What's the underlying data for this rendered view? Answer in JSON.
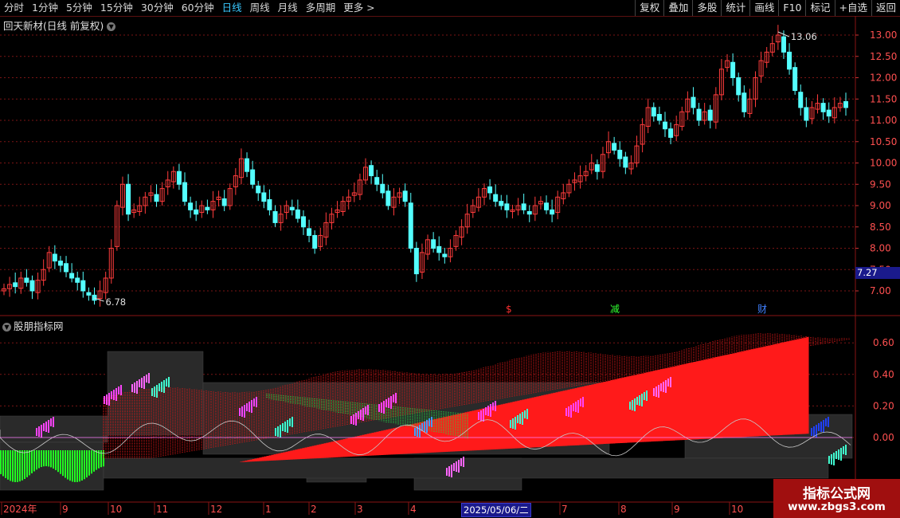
{
  "toolbar": {
    "periods": [
      "分时",
      "1分钟",
      "5分钟",
      "15分钟",
      "30分钟",
      "60分钟",
      "日线",
      "周线",
      "月线",
      "多周期",
      "更多 >"
    ],
    "active_period": "日线",
    "buttons": [
      "复权",
      "叠加",
      "多股",
      "统计",
      "画线",
      "F10",
      "标记",
      "+自选",
      "返回"
    ]
  },
  "colors": {
    "up": "#ff3c3c",
    "down": "#54ffff",
    "grid": "#7a1414",
    "accent": "#39c8ff",
    "event_red": "#ff3030",
    "event_green": "#30ff30",
    "event_blue": "#4080ff"
  },
  "main_chart": {
    "title": "回天新材(日线 前复权)",
    "y_ticks": [
      "13.00",
      "12.50",
      "12.00",
      "11.50",
      "11.00",
      "10.50",
      "10.00",
      "9.50",
      "9.00",
      "8.50",
      "8.00",
      "7.50",
      "7.00"
    ],
    "high_label": "13.06",
    "low_label": "6.78",
    "current_price": "7.27",
    "events": [
      {
        "text": "$"
      },
      {
        "text": "减"
      },
      {
        "text": "财"
      }
    ]
  },
  "indicator": {
    "title": "股朋指标网",
    "y_ticks": [
      "0.60",
      "0.40",
      "0.20",
      "0.00"
    ]
  },
  "x_axis": {
    "labels": [
      "2024年",
      "9",
      "10",
      "11",
      "12",
      "1",
      "2",
      "3",
      "4",
      "7",
      "8",
      "9",
      "10"
    ],
    "cursor_date": "2025/05/06/二"
  },
  "watermark": {
    "line1": "指标公式网",
    "line2": "www.zbgs3.com"
  },
  "chart_data": {
    "type": "candlestick",
    "title": "回天新材(日线 前复权)",
    "x_start": "2024-08",
    "x_end": "2025-10",
    "ylim": [
      6.7,
      13.2
    ],
    "closes": [
      7.05,
      7.15,
      7.1,
      7.3,
      7.2,
      7.0,
      7.25,
      7.5,
      7.9,
      7.7,
      7.6,
      7.45,
      7.3,
      7.2,
      7.0,
      6.9,
      6.78,
      7.0,
      7.3,
      8.0,
      9.0,
      9.5,
      8.8,
      8.9,
      9.0,
      9.2,
      9.3,
      9.1,
      9.4,
      9.6,
      9.8,
      9.5,
      9.1,
      8.9,
      8.8,
      9.0,
      8.9,
      9.1,
      9.2,
      9.0,
      9.4,
      9.7,
      10.1,
      9.8,
      9.5,
      9.3,
      9.1,
      8.9,
      8.6,
      8.8,
      9.0,
      8.9,
      8.7,
      8.5,
      8.3,
      8.0,
      8.3,
      8.6,
      8.8,
      8.9,
      9.1,
      9.2,
      9.3,
      9.6,
      9.9,
      9.7,
      9.5,
      9.3,
      9.0,
      9.2,
      9.3,
      9.1,
      8.0,
      7.4,
      7.9,
      8.2,
      8.0,
      7.9,
      7.8,
      8.0,
      8.3,
      8.5,
      8.8,
      9.0,
      9.2,
      9.4,
      9.3,
      9.1,
      9.0,
      8.9,
      8.9,
      9.0,
      8.9,
      8.8,
      9.0,
      9.1,
      8.9,
      8.8,
      9.2,
      9.3,
      9.5,
      9.6,
      9.7,
      9.8,
      10.0,
      9.8,
      10.2,
      10.5,
      10.3,
      10.1,
      9.9,
      10.0,
      10.4,
      10.9,
      11.3,
      11.1,
      11.0,
      10.8,
      10.6,
      10.9,
      11.2,
      11.5,
      11.3,
      11.0,
      11.2,
      11.0,
      11.6,
      12.2,
      12.4,
      12.0,
      11.6,
      11.2,
      11.5,
      12.0,
      12.4,
      12.6,
      12.8,
      13.0,
      12.6,
      12.2,
      11.7,
      11.3,
      11.0,
      11.3,
      11.4,
      11.2,
      11.1,
      11.3,
      11.4,
      11.3
    ]
  }
}
